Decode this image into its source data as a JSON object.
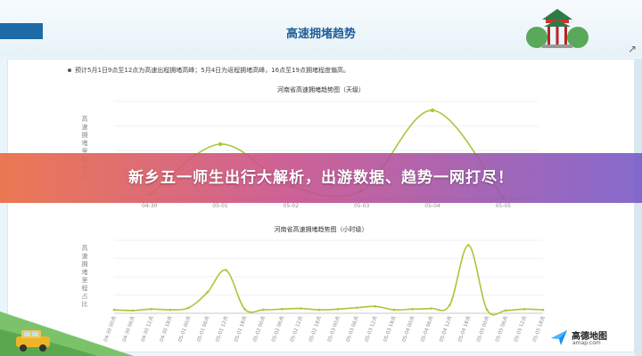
{
  "header": {
    "title": "高速拥堵趋势"
  },
  "note": "预计5月1日9点至12点为高速出程拥堵高峰；5月4日为返程拥堵高峰，16点至19点拥堵程度偏高。",
  "banner": "新乡五一师生出行大解析，出游数据、趋势一网打尽！",
  "logo": {
    "name": "高德地图",
    "url": "amap.com"
  },
  "colors": {
    "line": "#a6c83a",
    "banner_start": "#eb6e46",
    "banner_end": "#785ac8",
    "title_blue": "#1f5e99"
  },
  "chart_data": [
    {
      "type": "line",
      "title": "河南省高速拥堵趋势图（天级）",
      "ylabel": "高速拥堵里程占比",
      "x": [
        "04-30",
        "05-01",
        "05-02",
        "05-03",
        "05-04",
        "05-05"
      ],
      "series": [
        {
          "values": [
            0.05,
            0.62,
            0.15,
            0.1,
            1.0,
            0.02
          ]
        }
      ],
      "ylim": [
        0,
        1.1
      ],
      "grid": true
    },
    {
      "type": "line",
      "title": "河南省高速拥堵趋势图（小时级）",
      "ylabel": "高速拥堵里程占比",
      "x": [
        "04-30 00点",
        "04-30 06点",
        "04-30 12点",
        "04-30 18点",
        "05-01 00点",
        "05-01 06点",
        "05-01 12点",
        "05-01 18点",
        "05-02 00点",
        "05-02 06点",
        "05-02 12点",
        "05-02 18点",
        "05-03 00点",
        "05-03 06点",
        "05-03 12点",
        "05-03 18点",
        "05-04 00点",
        "05-04 06点",
        "05-04 12点",
        "05-04 18点",
        "05-05 00点",
        "05-05 06点",
        "05-05 12点",
        "05-05 18点"
      ],
      "series": [
        {
          "values": [
            0.05,
            0.04,
            0.06,
            0.05,
            0.08,
            0.3,
            0.62,
            0.06,
            0.05,
            0.06,
            0.07,
            0.05,
            0.06,
            0.08,
            0.1,
            0.05,
            0.06,
            0.07,
            0.12,
            0.98,
            0.05,
            0.04,
            0.06,
            0.05
          ]
        }
      ],
      "ylim": [
        0,
        1.05
      ],
      "grid": true
    }
  ]
}
